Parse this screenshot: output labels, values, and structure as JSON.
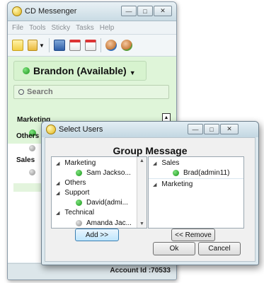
{
  "main_window": {
    "title": "CD Messenger",
    "menu": [
      "File",
      "Tools",
      "Sticky",
      "Tasks",
      "Help"
    ],
    "toolbar_icons": [
      "note-icon",
      "folder-icon",
      "dropdown-icon",
      "notebook-icon",
      "calendar-icon",
      "calendar-7-icon",
      "contacts-icon",
      "group-icon"
    ],
    "status": "Brandon (Available)",
    "search_placeholder": "Search",
    "groups": [
      {
        "name": "Marketing"
      },
      {
        "name": "Others"
      },
      {
        "name": "Sales"
      }
    ],
    "account_id": "Account Id :70533"
  },
  "dialog": {
    "title": "Select Users",
    "heading": "Group Message",
    "left_tree": [
      {
        "label": "Marketing",
        "type": "group"
      },
      {
        "label": "Sam Jackso...",
        "type": "user"
      },
      {
        "label": "Others",
        "type": "group"
      },
      {
        "label": "Support",
        "type": "group"
      },
      {
        "label": "David(admi...",
        "type": "user"
      },
      {
        "label": "Technical",
        "type": "group"
      },
      {
        "label": "Amanda Jac...",
        "type": "user"
      }
    ],
    "right_tree": [
      {
        "label": "Sales",
        "type": "group"
      },
      {
        "label": "Brad(admin11)",
        "type": "user"
      },
      {
        "label": "Marketing",
        "type": "group"
      }
    ],
    "add_button": "Add >>",
    "remove_button": "<< Remove",
    "ok_button": "Ok",
    "cancel_button": "Cancel"
  },
  "colors": {
    "available_green": "#169316",
    "status_bg": "#dff5d9",
    "window_frame": "#dfe9ee"
  }
}
